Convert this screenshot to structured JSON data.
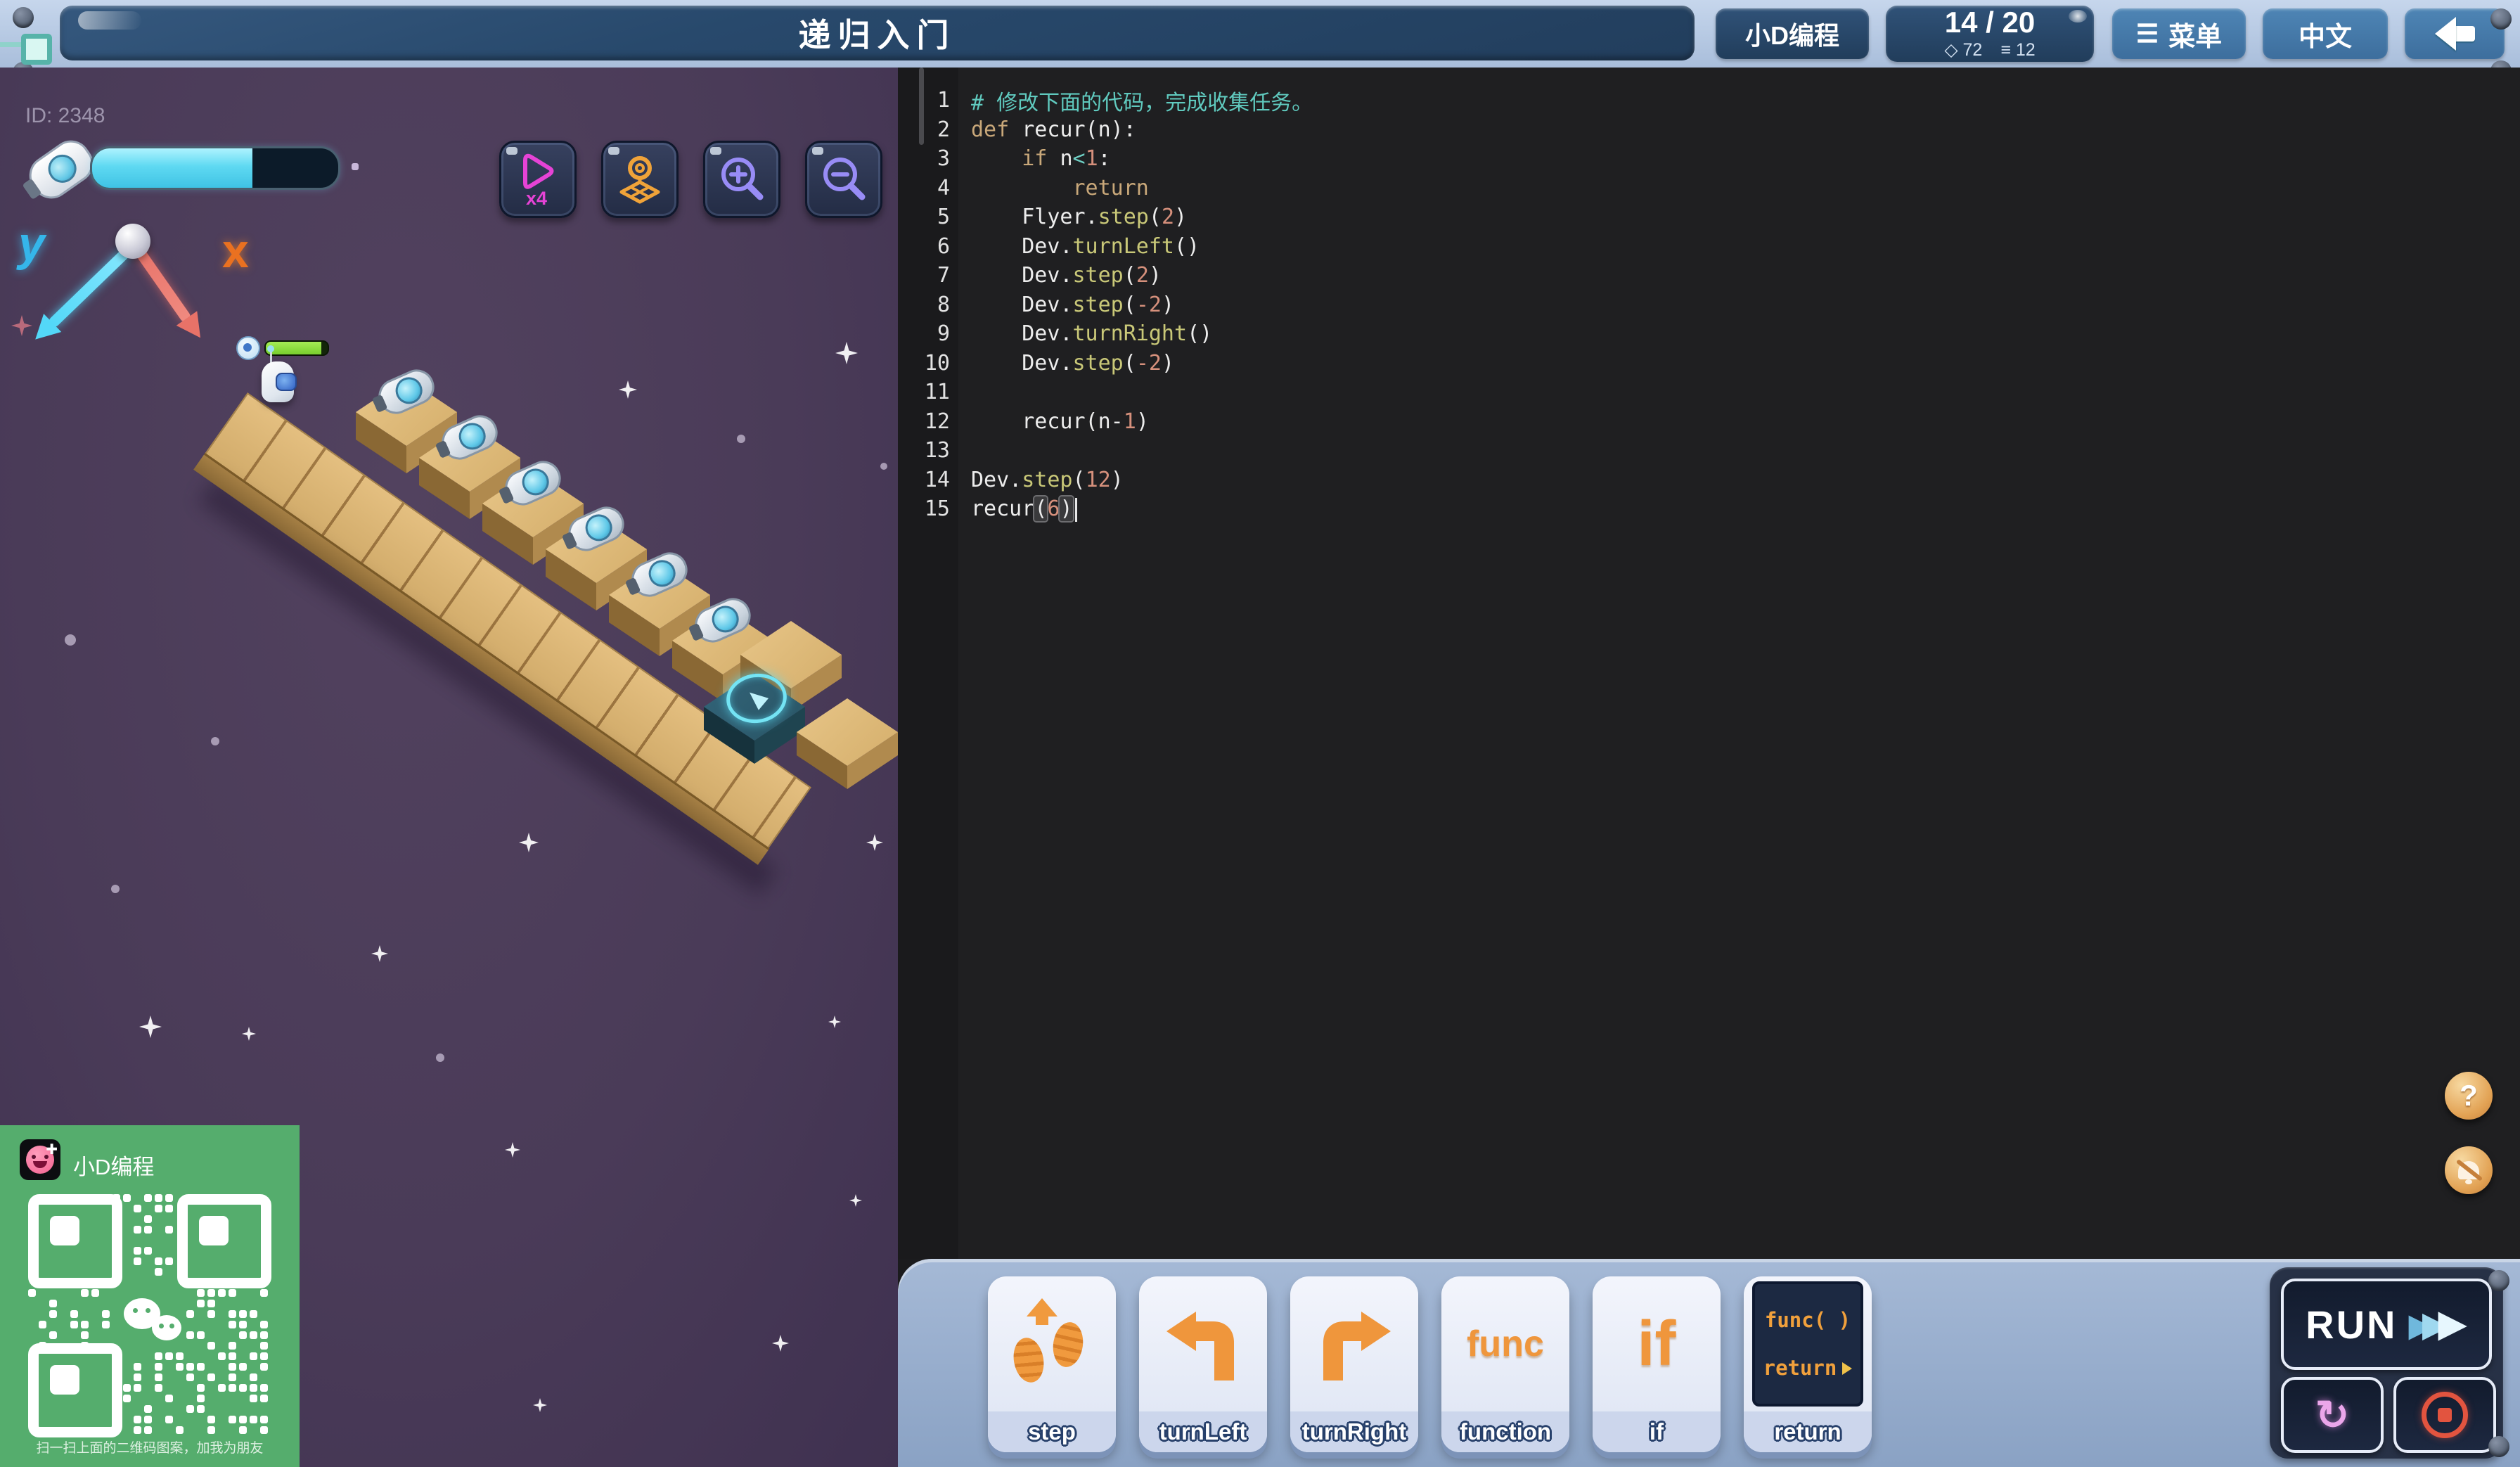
{
  "colors": {
    "top_frame": "#b9cbe4",
    "navy_button": "#28496c",
    "steel_button": "#477cab",
    "game_purple": "#4a3b58",
    "wood": "#dcb777",
    "portal_teal": "#2d5a6e",
    "editor_bg": "#1f1f21",
    "comment_teal": "#60cabf",
    "keyword_tan": "#c9a87a",
    "function_yellow": "#c9c878",
    "number_salmon": "#d6907c",
    "toolbar_blue": "#8fa6c4",
    "card_orange": "#ef963c",
    "run_navy": "#273146",
    "energy_cyan": "#5fd9f2",
    "health_green": "#77cf2d",
    "qr_green": "#55ad6d",
    "stop_red": "#e2543f",
    "reset_pink": "#eba6ea"
  },
  "topbar": {
    "title": "递归入门",
    "brand_button": "小D编程",
    "level_display": "14 / 20",
    "gem_icon": "◇",
    "gem_count": "72",
    "list_icon": "≡",
    "list_count": "12",
    "menu_icon": "☰",
    "menu_button": "菜单",
    "lang_button": "中文"
  },
  "game": {
    "player_id": "ID: 2348",
    "energy_percent": 65,
    "character_health_percent": 90,
    "axis_y": "y",
    "axis_x": "x",
    "speed_multiplier": "x4",
    "collectible_count": 6
  },
  "qr": {
    "app_name": "小D编程",
    "caption": "扫一扫上面的二维码图案，加我为朋友"
  },
  "editor": {
    "lines": [
      [
        [
          "com",
          "# 修改下面的代码，完成收集任务。"
        ]
      ],
      [
        [
          "kw",
          "def "
        ],
        [
          "pl",
          "recur(n):"
        ]
      ],
      [
        [
          "pl",
          "    "
        ],
        [
          "kw",
          "if "
        ],
        [
          "pl",
          "n"
        ],
        [
          "op",
          "<"
        ],
        [
          "num",
          "1"
        ],
        [
          "pl",
          ":"
        ]
      ],
      [
        [
          "pl",
          "        "
        ],
        [
          "kw",
          "return"
        ]
      ],
      [
        [
          "pl",
          "    Flyer."
        ],
        [
          "fn",
          "step"
        ],
        [
          "pl",
          "("
        ],
        [
          "num",
          "2"
        ],
        [
          "pl",
          ")"
        ]
      ],
      [
        [
          "pl",
          "    Dev."
        ],
        [
          "fn",
          "turnLeft"
        ],
        [
          "pl",
          "()"
        ]
      ],
      [
        [
          "pl",
          "    Dev."
        ],
        [
          "fn",
          "step"
        ],
        [
          "pl",
          "("
        ],
        [
          "num",
          "2"
        ],
        [
          "pl",
          ")"
        ]
      ],
      [
        [
          "pl",
          "    Dev."
        ],
        [
          "fn",
          "step"
        ],
        [
          "pl",
          "("
        ],
        [
          "num",
          "-2"
        ],
        [
          "pl",
          ")"
        ]
      ],
      [
        [
          "pl",
          "    Dev."
        ],
        [
          "fn",
          "turnRight"
        ],
        [
          "pl",
          "()"
        ]
      ],
      [
        [
          "pl",
          "    Dev."
        ],
        [
          "fn",
          "step"
        ],
        [
          "pl",
          "("
        ],
        [
          "num",
          "-2"
        ],
        [
          "pl",
          ")"
        ]
      ],
      [],
      [
        [
          "pl",
          "    recur(n-"
        ],
        [
          "num",
          "1"
        ],
        [
          "pl",
          ")"
        ]
      ],
      [],
      [
        [
          "pl",
          "Dev."
        ],
        [
          "fn",
          "step"
        ],
        [
          "pl",
          "("
        ],
        [
          "num",
          "12"
        ],
        [
          "pl",
          ")"
        ]
      ],
      [
        [
          "pl",
          "recur"
        ],
        [
          "match",
          "("
        ],
        [
          "num",
          "6"
        ],
        [
          "match",
          ")"
        ],
        [
          "caret",
          ""
        ]
      ]
    ]
  },
  "toolbar": {
    "cards": [
      {
        "label": "step"
      },
      {
        "label": "turnLeft"
      },
      {
        "label": "turnRight"
      },
      {
        "label": "function",
        "icon_text": "func"
      },
      {
        "label": "if",
        "icon_text": "if"
      },
      {
        "label": "return",
        "icon_text_top": "func( )",
        "icon_text_bottom": "return"
      }
    ],
    "run_label": "RUN"
  }
}
